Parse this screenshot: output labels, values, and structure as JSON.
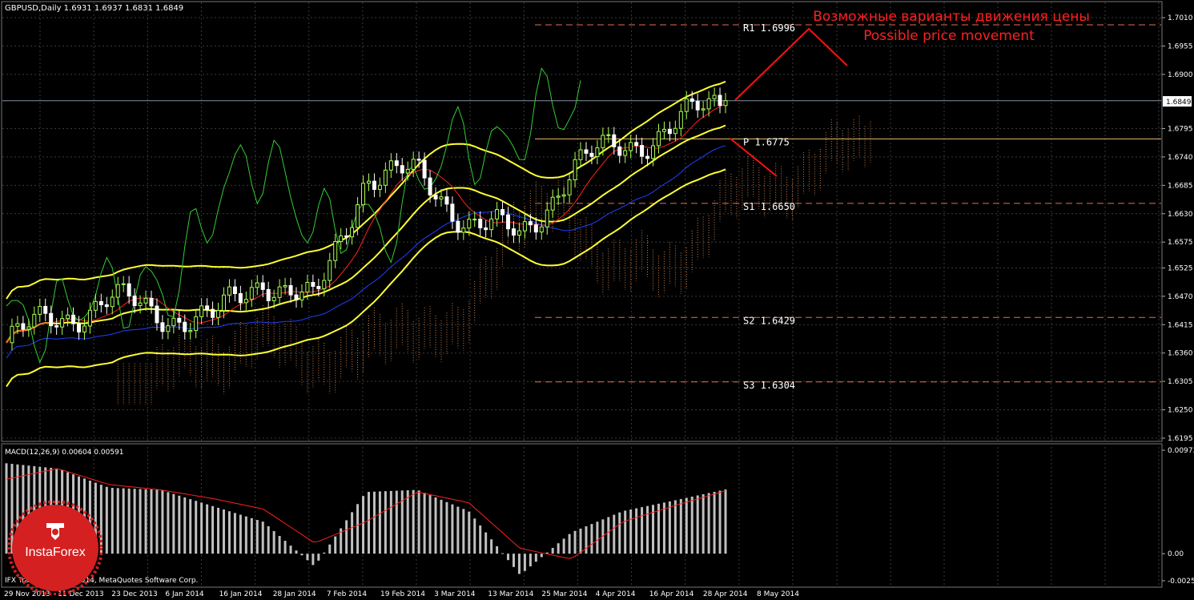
{
  "header": {
    "symbol_line": "GBPUSD,Daily  1.6931 1.6937 1.6831 1.6849"
  },
  "annotation": {
    "line1": "Возможные варианты движения цены",
    "line2": "Possible price movement"
  },
  "levels": [
    {
      "name": "R1",
      "label": "R1 1.6996",
      "value": 1.6996,
      "color": "#e07050",
      "style": "dashed"
    },
    {
      "name": "P",
      "label": "P 1.6775",
      "value": 1.6775,
      "color": "#e8c070",
      "style": "solid"
    },
    {
      "name": "S1",
      "label": "S1 1.6650",
      "value": 1.665,
      "color": "#e07050",
      "style": "dashed"
    },
    {
      "name": "S2",
      "label": "S2 1.6429",
      "value": 1.6429,
      "color": "#e07050",
      "style": "dashed"
    },
    {
      "name": "S3",
      "label": "S3 1.6304",
      "value": 1.6304,
      "color": "#e07050",
      "style": "dashed"
    }
  ],
  "current_price": {
    "label": "1.6849",
    "value": 1.6849
  },
  "price_ticks": [
    "1.7010",
    "1.6955",
    "1.6900",
    "1.6795",
    "1.6740",
    "1.6685",
    "1.6630",
    "1.6575",
    "1.6525",
    "1.6470",
    "1.6415",
    "1.6360",
    "1.6305",
    "1.6250",
    "1.6195"
  ],
  "date_ticks": [
    "29 Nov 2013",
    "11 Dec 2013",
    "23 Dec 2013",
    "6 Jan 2014",
    "16 Jan 2014",
    "28 Jan 2014",
    "7 Feb 2014",
    "19 Feb 2014",
    "3 Mar 2014",
    "13 Mar 2014",
    "25 Mar 2014",
    "4 Apr 2014",
    "16 Apr 2014",
    "28 Apr 2014",
    "8 May 2014"
  ],
  "macd": {
    "label": "MACD(12,26,9) 0.00604 0.00591",
    "ticks": [
      "0.00973",
      "0.00",
      "-0.00255"
    ]
  },
  "footer": {
    "copyright": "IFX Trader, © 2001-2014, MetaQuotes Software Corp."
  },
  "logo": {
    "text": "InstaForex",
    "color": "#d42020"
  },
  "colors": {
    "bull": "#aaff55",
    "bear": "#ffffff",
    "bollinger": "#ffff33",
    "tenkan": "#ff2020",
    "kijun": "#2040ff",
    "chikou": "#33cc33",
    "kumo": "#ffa060",
    "grid": "#3a3a3a",
    "macd_hist": "#c0c0c0",
    "macd_signal": "#ff2020",
    "annotation": "#ff2020"
  },
  "chart_data": {
    "type": "line",
    "title": "GBPUSD,Daily",
    "ohlc_last": {
      "open": 1.6931,
      "high": 1.6937,
      "low": 1.6831,
      "close": 1.6849
    },
    "x": [
      "29 Nov 2013",
      "11 Dec 2013",
      "23 Dec 2013",
      "6 Jan 2014",
      "16 Jan 2014",
      "28 Jan 2014",
      "7 Feb 2014",
      "19 Feb 2014",
      "3 Mar 2014",
      "13 Mar 2014",
      "25 Mar 2014",
      "4 Apr 2014",
      "16 Apr 2014",
      "28 Apr 2014",
      "8 May 2014"
    ],
    "series": [
      {
        "name": "close",
        "values": [
          1.638,
          1.643,
          1.646,
          1.644,
          1.642,
          1.651,
          1.645,
          1.671,
          1.67,
          1.662,
          1.658,
          1.672,
          1.676,
          1.68,
          1.6849
        ]
      }
    ],
    "ylim": [
      1.6195,
      1.704
    ],
    "macd_ylim": [
      -0.00255,
      0.00973
    ],
    "macd_values": [
      0.0085,
      0.008,
      0.0062,
      0.006,
      0.0045,
      0.003,
      -0.0012,
      0.0058,
      0.006,
      0.004,
      -0.002,
      0.002,
      0.004,
      0.005,
      0.00604
    ],
    "macd_signal": [
      0.007,
      0.008,
      0.0065,
      0.006,
      0.0052,
      0.0042,
      0.001,
      0.003,
      0.0058,
      0.0048,
      0.0005,
      -0.0005,
      0.003,
      0.0045,
      0.00591
    ]
  }
}
